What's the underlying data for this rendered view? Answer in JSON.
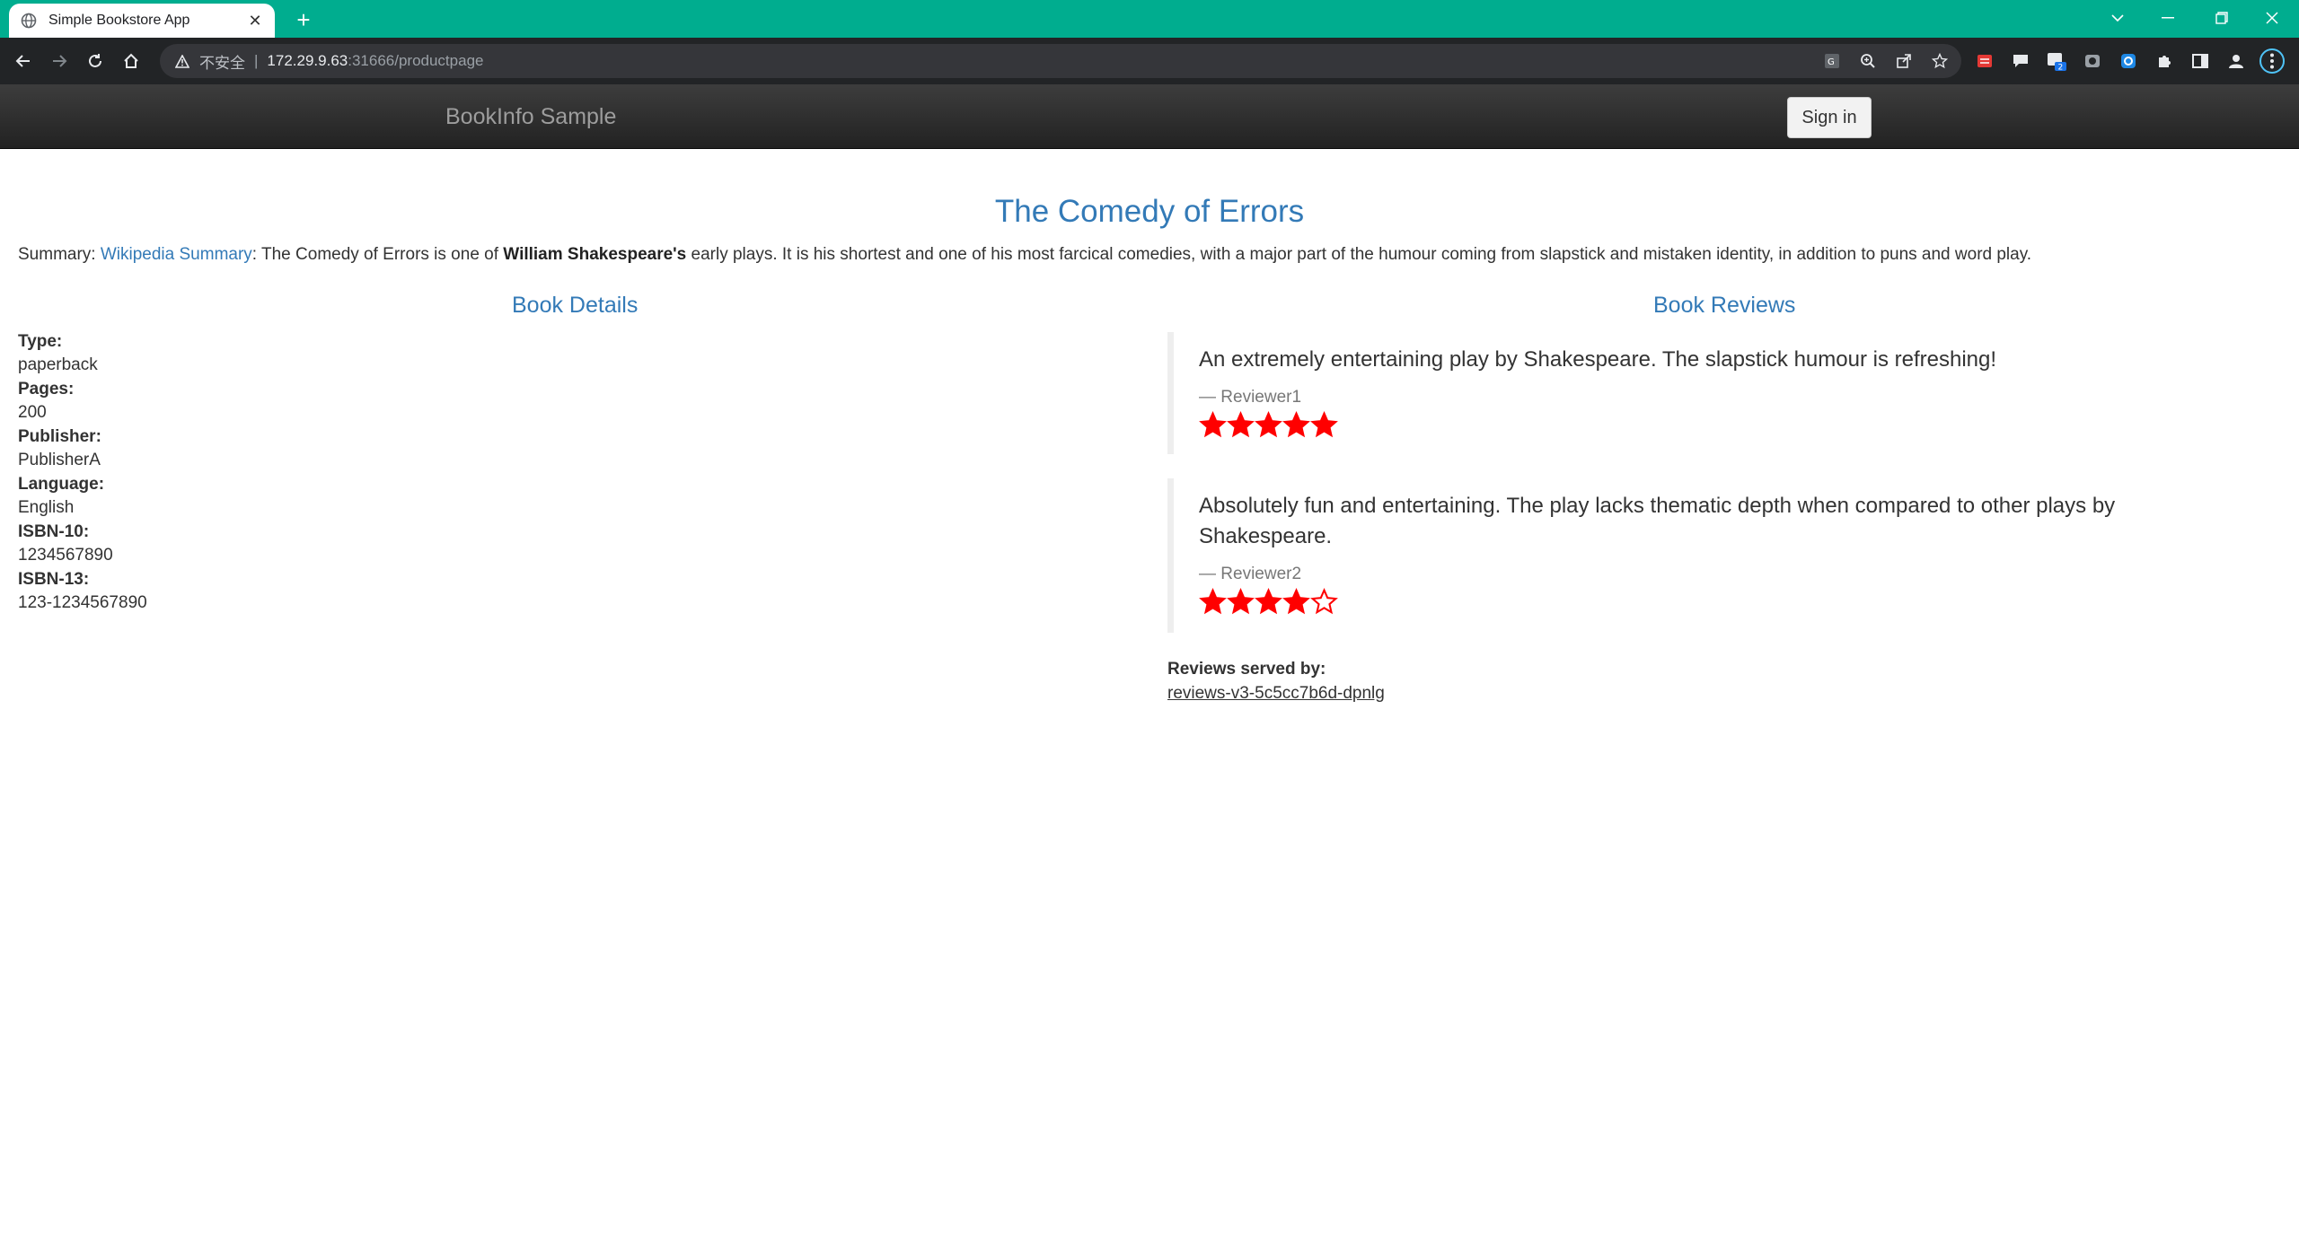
{
  "browser": {
    "tab_title": "Simple Bookstore App",
    "url_insecure_label": "不安全",
    "url_host": "172.29.9.63",
    "url_rest": ":31666/productpage",
    "ext_badge": "2"
  },
  "navbar": {
    "brand": "BookInfo Sample",
    "signin_label": "Sign in"
  },
  "book": {
    "title": "The Comedy of Errors",
    "summary_prefix": "Summary: ",
    "summary_link": "Wikipedia Summary",
    "summary_mid": ": The Comedy of Errors is one of ",
    "summary_bold": "William Shakespeare's",
    "summary_suffix": " early plays. It is his shortest and one of his most farcical comedies, with a major part of the humour coming from slapstick and mistaken identity, in addition to puns and word play."
  },
  "details": {
    "heading": "Book Details",
    "items": [
      {
        "label": "Type:",
        "value": "paperback"
      },
      {
        "label": "Pages:",
        "value": "200"
      },
      {
        "label": "Publisher:",
        "value": "PublisherA"
      },
      {
        "label": "Language:",
        "value": "English"
      },
      {
        "label": "ISBN-10:",
        "value": "1234567890"
      },
      {
        "label": "ISBN-13:",
        "value": "123-1234567890"
      }
    ]
  },
  "reviews": {
    "heading": "Book Reviews",
    "star_color": "#ff0000",
    "items": [
      {
        "text": "An extremely entertaining play by Shakespeare. The slapstick humour is refreshing!",
        "reviewer": "— Reviewer1",
        "rating": 5
      },
      {
        "text": "Absolutely fun and entertaining. The play lacks thematic depth when compared to other plays by Shakespeare.",
        "reviewer": "— Reviewer2",
        "rating": 4
      }
    ],
    "served_by_label": "Reviews served by:",
    "served_by_value": "reviews-v3-5c5cc7b6d-dpnlg"
  }
}
